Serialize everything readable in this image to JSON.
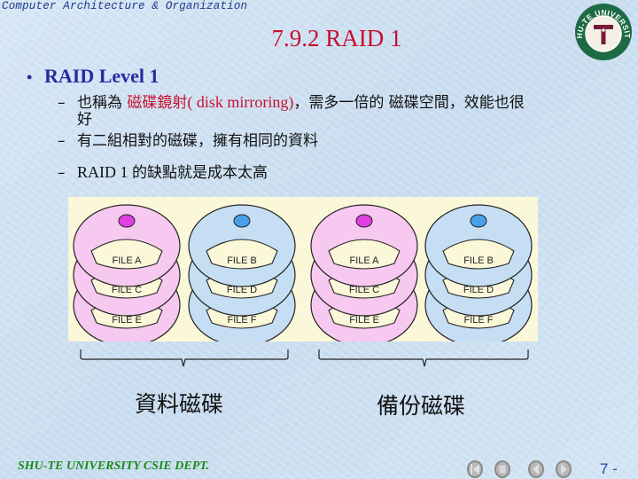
{
  "header": {
    "course_title": "Computer Architecture & Organization",
    "slide_title": "7.9.2 RAID 1",
    "logo_text": "SHU-TE UNIVERSITY",
    "logo_letter": "T"
  },
  "content": {
    "bullet": "RAID Level 1",
    "bullet_marker": "•",
    "dash": "–",
    "sub_items": [
      {
        "prefix": "也稱為 ",
        "highlight": "磁碟鏡射",
        "highlight_en": "( disk mirroring)",
        "suffix": "，需多一倍的 磁碟空間，效能也很",
        "continuation": "好"
      },
      {
        "text": "有二組相對的磁碟，擁有相同的資料"
      },
      {
        "text_en": "RAID 1 ",
        "text": "的缺點就是成本太高"
      }
    ]
  },
  "diagram": {
    "disks": [
      {
        "group": "data",
        "color": "pink",
        "files": [
          "FILE A",
          "FILE C",
          "FILE E"
        ]
      },
      {
        "group": "data",
        "color": "blue",
        "files": [
          "FILE B",
          "FILE D",
          "FILE F"
        ]
      },
      {
        "group": "backup",
        "color": "pink",
        "files": [
          "FILE A",
          "FILE C",
          "FILE E"
        ]
      },
      {
        "group": "backup",
        "color": "blue",
        "files": [
          "FILE B",
          "FILE D",
          "FILE F"
        ]
      }
    ],
    "labels": {
      "data_disks": "資料磁碟",
      "backup_disks": "備份磁碟"
    },
    "colors": {
      "pink_fill": "#f7c8f0",
      "pink_hub": "#e040e0",
      "blue_fill": "#c5def4",
      "blue_hub": "#4aa0e8",
      "label_fill": "#fbf8d9",
      "background": "#fbf8d9"
    }
  },
  "footer": {
    "text": "SHU-TE UNIVERSITY  CSIE DEPT.",
    "page_number": "7 -",
    "nav_buttons": [
      "first",
      "stop",
      "previous",
      "next"
    ]
  }
}
